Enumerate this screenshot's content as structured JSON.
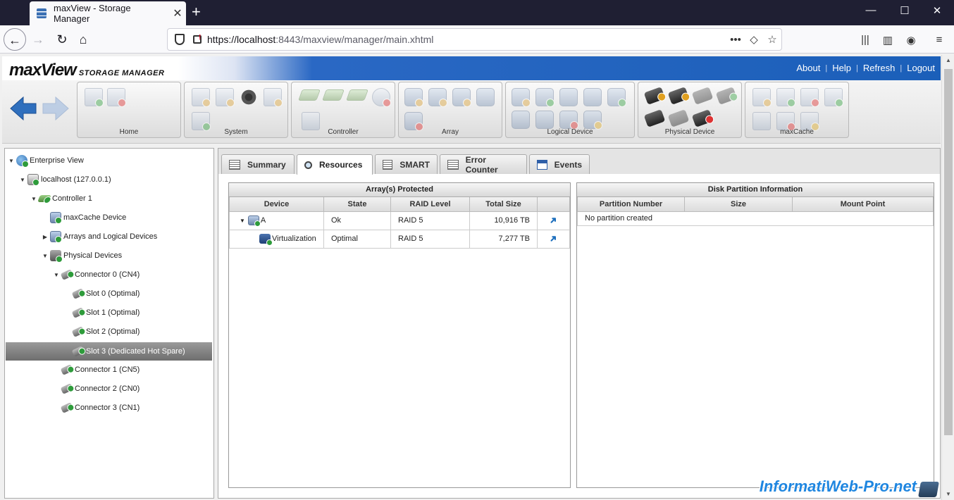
{
  "browser": {
    "tab_title": "maxView - Storage Manager",
    "url_host": "https://localhost",
    "url_rest": ":8443/maxview/manager/main.xhtml"
  },
  "app": {
    "logo": "maxView",
    "logo_subtitle": "STORAGE MANAGER",
    "menu": [
      "About",
      "Help",
      "Refresh",
      "Logout"
    ],
    "groups": [
      "Home",
      "System",
      "Controller",
      "Array",
      "Logical Device",
      "Physical Device",
      "maxCache"
    ]
  },
  "tree": [
    {
      "label": "Enterprise View"
    },
    {
      "label": "localhost (127.0.0.1)"
    },
    {
      "label": "Controller 1"
    },
    {
      "label": "maxCache Device"
    },
    {
      "label": "Arrays and Logical Devices"
    },
    {
      "label": "Physical Devices"
    },
    {
      "label": "Connector 0 (CN4)"
    },
    {
      "label": "Slot 0 (Optimal)"
    },
    {
      "label": "Slot 1 (Optimal)"
    },
    {
      "label": "Slot 2 (Optimal)"
    },
    {
      "label": "Slot 3 (Dedicated Hot Spare)"
    },
    {
      "label": "Connector 1 (CN5)"
    },
    {
      "label": "Connector 2 (CN0)"
    },
    {
      "label": "Connector 3 (CN1)"
    }
  ],
  "tabs": [
    "Summary",
    "Resources",
    "SMART",
    "Error Counter",
    "Events"
  ],
  "arrays_protected": {
    "title": "Array(s) Protected",
    "columns": [
      "Device",
      "State",
      "RAID Level",
      "Total Size"
    ],
    "rows": [
      {
        "device": "A",
        "state": "Ok",
        "raid": "RAID 5",
        "size": "10,916 TB"
      },
      {
        "device": "Virtualization",
        "state": "Optimal",
        "raid": "RAID 5",
        "size": "7,277 TB"
      }
    ]
  },
  "partitions": {
    "title": "Disk Partition Information",
    "columns": [
      "Partition Number",
      "Size",
      "Mount Point"
    ],
    "empty": "No partition created"
  },
  "watermark": "InformatiWeb-Pro.net"
}
